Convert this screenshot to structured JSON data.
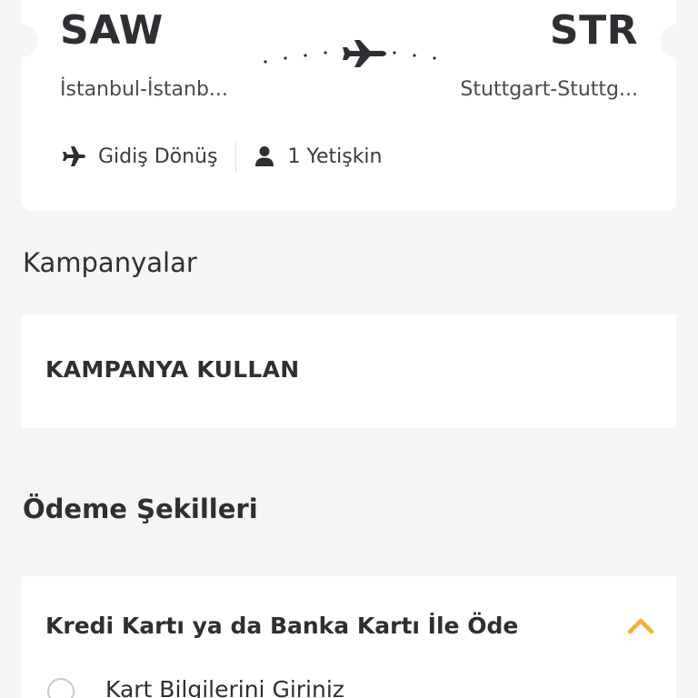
{
  "flight": {
    "from_code": "SAW",
    "from_city": "İstanbul-İstanb...",
    "to_code": "STR",
    "to_city": "Stuttgart-Stuttg...",
    "trip_type": "Gidiş Dönüş",
    "passengers": "1 Yetişkin"
  },
  "campaigns": {
    "title": "Kampanyalar",
    "use_label": "KAMPANYA KULLAN"
  },
  "payment": {
    "title": "Ödeme Şekilleri",
    "method_title": "Kredi Kartı ya da Banka Kartı İle Öde",
    "card_info_label": "Kart Bilgilerini Giriniz"
  },
  "icons": {
    "route": "airplane-icon",
    "trip_type": "airplane-icon",
    "passengers": "person-icon",
    "expand": "chevron-up-icon"
  },
  "colors": {
    "background": "#f5f5f6",
    "card": "#ffffff",
    "text": "#2e2e33",
    "accent": "#f2b233"
  }
}
